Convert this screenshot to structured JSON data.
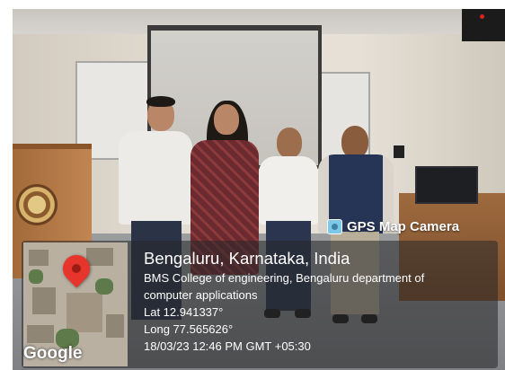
{
  "overlay": {
    "app_label": "GPS Map Camera",
    "app_icon": "map-camera-icon",
    "location_title": "Bengaluru, Karnataka, India",
    "address_line1": "BMS College of engineering, Bengaluru department of",
    "address_line2": "computer applications",
    "latitude": "Lat 12.941337°",
    "longitude": "Long 77.565626°",
    "datetime": "18/03/23 12:46 PM GMT +05:30"
  },
  "map": {
    "watermark": "Google",
    "pin_color": "#e8352b"
  }
}
